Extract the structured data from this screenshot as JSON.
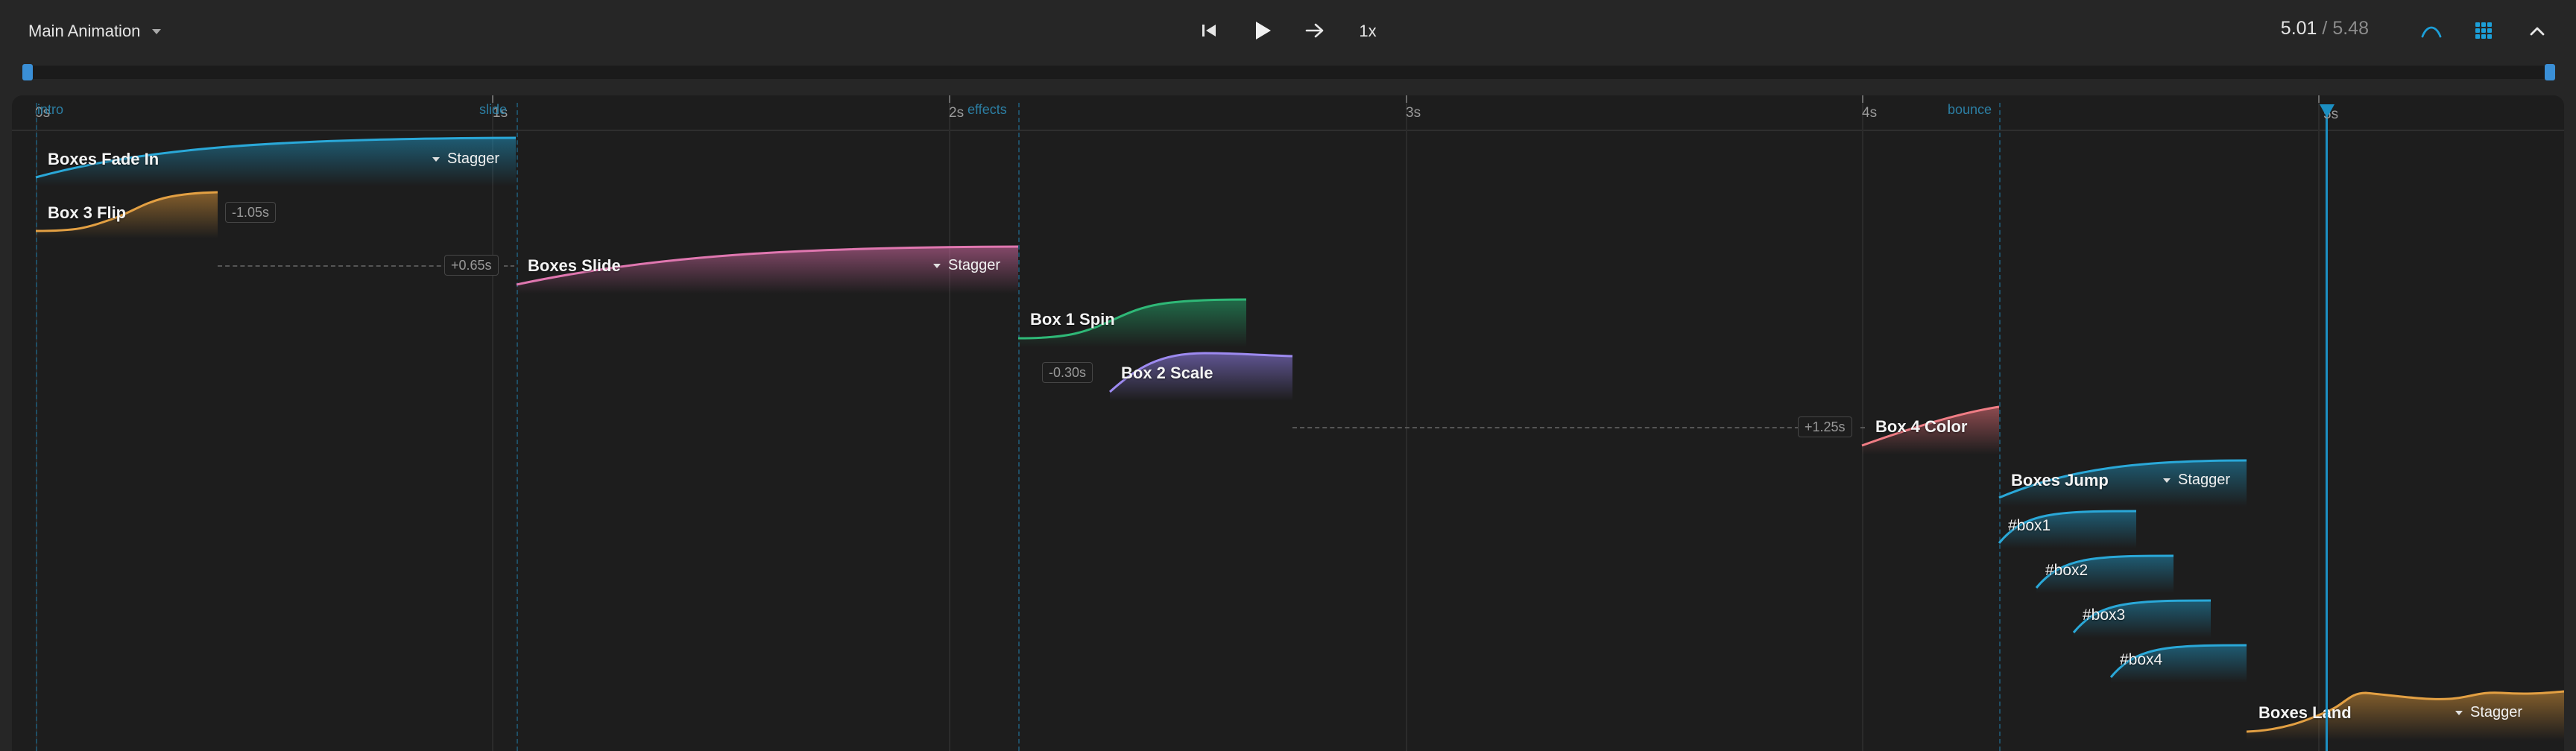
{
  "toolbar": {
    "title": "Main Animation",
    "speed": "1x",
    "time_current": "5.01",
    "time_separator": "/",
    "time_total": "5.48",
    "icons": [
      "skip-to-start-icon",
      "play-icon",
      "loop-arrow-icon",
      "curve-icon",
      "grid-icon",
      "chevron-up-icon"
    ],
    "accent_color": "#1c9fd8"
  },
  "ruler": {
    "ticks": [
      "0s",
      "1s",
      "2s",
      "3s",
      "4s",
      "5s"
    ],
    "markers": [
      "intro",
      "slide",
      "effects",
      "bounce"
    ]
  },
  "playhead": {
    "time_s": 5.01,
    "label": "5s",
    "color": "#1c8fc2"
  },
  "tracks": [
    {
      "name": "Boxes Fade In",
      "control": "Stagger",
      "color": "#2aa8d8"
    },
    {
      "name": "Box 3 Flip",
      "offset": "-1.05s",
      "color": "#e3a043"
    },
    {
      "name": "Boxes Slide",
      "offset": "+0.65s",
      "control": "Stagger",
      "color": "#e077b0"
    },
    {
      "name": "Box 1 Spin",
      "color": "#2fb877"
    },
    {
      "name": "Box 2 Scale",
      "offset": "-0.30s",
      "color": "#9d8af0"
    },
    {
      "name": "Box 4 Color",
      "offset": "+1.25s",
      "color": "#f07d85"
    },
    {
      "name": "Boxes Jump",
      "control": "Stagger",
      "color": "#2aa8d8"
    },
    {
      "name": "#box1",
      "color": "#2aa8d8"
    },
    {
      "name": "#box2",
      "color": "#2aa8d8"
    },
    {
      "name": "#box3",
      "color": "#2aa8d8"
    },
    {
      "name": "#box4",
      "color": "#2aa8d8"
    },
    {
      "name": "Boxes Land",
      "control": "Stagger",
      "color": "#e3a043"
    }
  ]
}
